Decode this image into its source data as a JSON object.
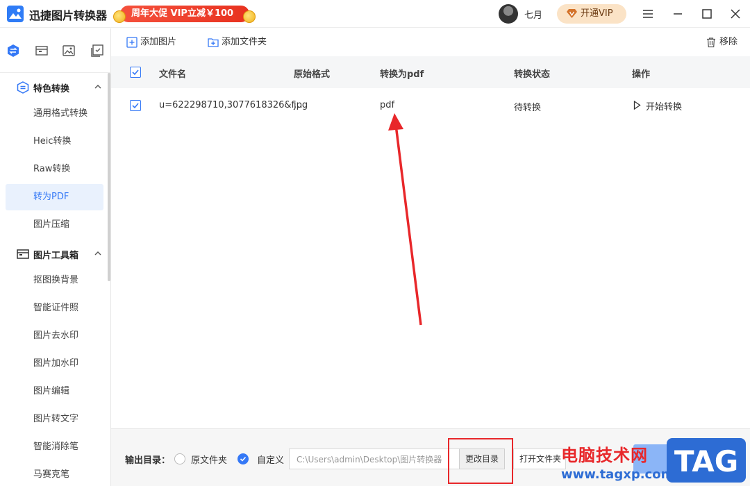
{
  "app": {
    "title": "迅捷图片转换器",
    "promo": "周年大促 VIP立减￥100",
    "username": "七月",
    "vip_label": "开通VIP"
  },
  "sidebar": {
    "groups": [
      {
        "label": "特色转换",
        "items": [
          "通用格式转换",
          "Heic转换",
          "Raw转换",
          "转为PDF",
          "图片压缩"
        ]
      },
      {
        "label": "图片工具箱",
        "items": [
          "抠图换背景",
          "智能证件照",
          "图片去水印",
          "图片加水印",
          "图片编辑",
          "图片转文字",
          "智能消除笔",
          "马赛克笔"
        ]
      }
    ],
    "active_item": "转为PDF"
  },
  "toolbar": {
    "add_image": "添加图片",
    "add_folder": "添加文件夹",
    "remove": "移除"
  },
  "table": {
    "columns": [
      "文件名",
      "原始格式",
      "转换为pdf",
      "转换状态",
      "操作"
    ],
    "rows": [
      {
        "checked": true,
        "filename": "u=622298710,3077618326&f...",
        "source_format": "jpg",
        "target_format": "pdf",
        "status": "待转换",
        "action": "开始转换"
      }
    ]
  },
  "footer": {
    "output_label": "输出目录：",
    "option_original": "原文件夹",
    "option_custom": "自定义",
    "selected_option": "自定义",
    "path_value": "C:\\Users\\admin\\Desktop\\图片转换器",
    "change_dir": "更改目录",
    "open_folder": "打开文件夹"
  },
  "watermark": {
    "text": "电脑技术网",
    "url": "www.tagxp.com",
    "logo": "TAG"
  },
  "colors": {
    "accent": "#3478f6",
    "promo_red": "#e8321f",
    "annotation_red": "#e8272a"
  }
}
